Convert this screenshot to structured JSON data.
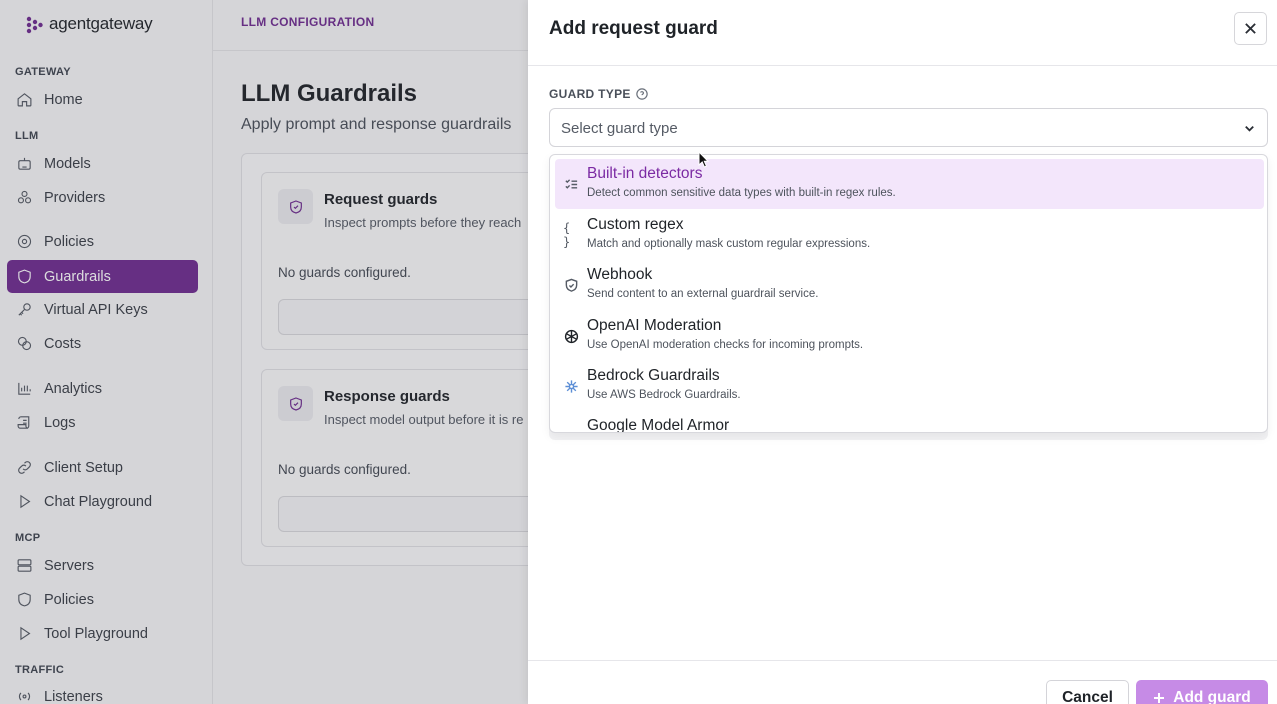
{
  "brand": {
    "name": "agentgateway",
    "accent": "#6f2c91"
  },
  "sidebar": {
    "sections": [
      {
        "label": "GATEWAY"
      },
      {
        "label": "LLM"
      },
      {
        "label": "MCP"
      },
      {
        "label": "TRAFFIC"
      }
    ],
    "items": [
      {
        "label": "Home",
        "icon": "home-icon"
      },
      {
        "label": "Models",
        "icon": "robot-icon"
      },
      {
        "label": "Providers",
        "icon": "cluster-icon"
      },
      {
        "label": "Policies",
        "icon": "gear-icon"
      },
      {
        "label": "Guardrails",
        "icon": "shield-icon",
        "active": true
      },
      {
        "label": "Virtual API Keys",
        "icon": "key-icon"
      },
      {
        "label": "Costs",
        "icon": "coins-icon"
      },
      {
        "label": "Analytics",
        "icon": "bar-chart-icon"
      },
      {
        "label": "Logs",
        "icon": "scroll-icon"
      },
      {
        "label": "Client Setup",
        "icon": "link-icon"
      },
      {
        "label": "Chat Playground",
        "icon": "play-icon"
      },
      {
        "label": "Servers",
        "icon": "server-icon"
      },
      {
        "label": "Policies",
        "icon": "shield-icon"
      },
      {
        "label": "Tool Playground",
        "icon": "play-icon"
      },
      {
        "label": "Listeners",
        "icon": "radio-icon"
      }
    ]
  },
  "main": {
    "breadcrumb": "LLM CONFIGURATION",
    "title": "LLM Guardrails",
    "subtitle": "Apply prompt and response guardrails",
    "request_guards": {
      "title": "Request guards",
      "desc": "Inspect prompts before they reach",
      "empty": "No guards configured."
    },
    "response_guards": {
      "title": "Response guards",
      "desc": "Inspect model output before it is re",
      "empty": "No guards configured."
    }
  },
  "drawer": {
    "title": "Add request guard",
    "field_label": "GUARD TYPE",
    "select_placeholder": "Select guard type",
    "options": [
      {
        "title": "Built-in detectors",
        "desc": "Detect common sensitive data types with built-in regex rules.",
        "icon": "checklist-icon",
        "highlighted": true
      },
      {
        "title": "Custom regex",
        "desc": "Match and optionally mask custom regular expressions.",
        "icon": "braces-icon"
      },
      {
        "title": "Webhook",
        "desc": "Send content to an external guardrail service.",
        "icon": "shield-check-icon"
      },
      {
        "title": "OpenAI Moderation",
        "desc": "Use OpenAI moderation checks for incoming prompts.",
        "icon": "openai-icon"
      },
      {
        "title": "Bedrock Guardrails",
        "desc": "Use AWS Bedrock Guardrails.",
        "icon": "bedrock-icon"
      },
      {
        "title": "Google Model Armor",
        "desc": "",
        "icon": "google-icon"
      }
    ],
    "cancel_label": "Cancel",
    "add_label": "Add guard"
  }
}
